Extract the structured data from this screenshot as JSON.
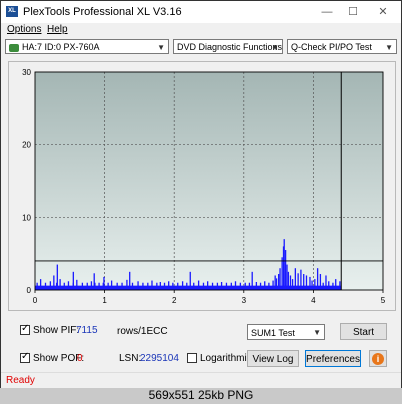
{
  "window": {
    "title": "PlexTools Professional XL V3.16",
    "icon": "XL"
  },
  "menu": [
    "Options",
    "Help"
  ],
  "toolbar": {
    "drive": "HA:7 ID:0  PX-760A",
    "function": "DVD Diagnostic Functions",
    "test": "Q-Check PI/PO Test"
  },
  "chart_data": {
    "type": "bar",
    "xlim": [
      0,
      5
    ],
    "ylim": [
      0,
      30
    ],
    "x_ticks": [
      "0",
      "1",
      "2",
      "3",
      "4",
      "5"
    ],
    "y_ticks": [
      "0",
      "10",
      "20",
      "30"
    ],
    "threshold": 4,
    "data_end_x": 4.4,
    "gridlines": true,
    "colors": {
      "bars": "#1a1aff",
      "grid": "#555555",
      "bg_top": "#a4b6b4",
      "bg_bottom": "#e8f0ee",
      "threshold": "#000000"
    },
    "series": [
      {
        "values": [
          [
            0.03,
            1
          ],
          [
            0.08,
            1.5
          ],
          [
            0.15,
            1
          ],
          [
            0.22,
            1.2
          ],
          [
            0.27,
            2
          ],
          [
            0.31,
            1
          ],
          [
            0.36,
            1.5
          ],
          [
            0.42,
            1
          ],
          [
            0.48,
            1.2
          ],
          [
            0.55,
            1
          ],
          [
            0.6,
            1.4
          ],
          [
            0.68,
            1
          ],
          [
            0.75,
            1
          ],
          [
            0.81,
            1.2
          ],
          [
            0.86,
            1
          ],
          [
            0.92,
            1
          ],
          [
            0.98,
            1
          ],
          [
            0.32,
            3.5
          ],
          [
            0.55,
            2.5
          ],
          [
            0.85,
            2.3
          ],
          [
            0.99,
            1.8
          ],
          [
            1.05,
            1
          ],
          [
            1.1,
            1.3
          ],
          [
            1.18,
            1
          ],
          [
            1.25,
            1
          ],
          [
            1.32,
            1.4
          ],
          [
            1.36,
            2.5
          ],
          [
            1.4,
            1
          ],
          [
            1.48,
            1.2
          ],
          [
            1.55,
            1
          ],
          [
            1.62,
            1
          ],
          [
            1.68,
            1.3
          ],
          [
            1.75,
            1
          ],
          [
            1.8,
            1.1
          ],
          [
            1.86,
            1
          ],
          [
            1.92,
            1.2
          ],
          [
            1.98,
            1
          ],
          [
            2.05,
            1
          ],
          [
            2.12,
            1.2
          ],
          [
            2.18,
            1
          ],
          [
            2.23,
            2.5
          ],
          [
            2.28,
            1
          ],
          [
            2.35,
            1.3
          ],
          [
            2.42,
            1
          ],
          [
            2.48,
            1.2
          ],
          [
            2.55,
            1
          ],
          [
            2.62,
            1
          ],
          [
            2.68,
            1.1
          ],
          [
            2.75,
            1
          ],
          [
            2.82,
            1
          ],
          [
            2.88,
            1.2
          ],
          [
            2.95,
            1
          ],
          [
            3.02,
            1
          ],
          [
            3.08,
            1
          ],
          [
            3.12,
            2.5
          ],
          [
            3.18,
            1.1
          ],
          [
            3.24,
            1
          ],
          [
            3.3,
            1.2
          ],
          [
            3.36,
            1
          ],
          [
            3.42,
            1.3
          ],
          [
            3.45,
            2
          ],
          [
            3.47,
            1.6
          ],
          [
            3.5,
            2.2
          ],
          [
            3.52,
            3
          ],
          [
            3.55,
            4.5
          ],
          [
            3.57,
            6
          ],
          [
            3.58,
            7
          ],
          [
            3.6,
            5.5
          ],
          [
            3.62,
            3.5
          ],
          [
            3.64,
            2.5
          ],
          [
            3.67,
            2
          ],
          [
            3.7,
            1.5
          ],
          [
            3.74,
            3
          ],
          [
            3.78,
            2.3
          ],
          [
            3.82,
            2.8
          ],
          [
            3.86,
            2.2
          ],
          [
            3.9,
            2
          ],
          [
            3.95,
            1.8
          ],
          [
            3.98,
            1.3
          ],
          [
            4.02,
            1.5
          ],
          [
            4.06,
            3
          ],
          [
            4.1,
            2.2
          ],
          [
            4.14,
            1
          ],
          [
            4.18,
            2
          ],
          [
            4.22,
            1.2
          ],
          [
            4.28,
            1
          ],
          [
            4.32,
            1.5
          ],
          [
            4.38,
            1.2
          ]
        ]
      }
    ]
  },
  "controls": {
    "show_pif_label": "Show PIF:",
    "pif_value": "7115",
    "rows_label": "rows/1ECC",
    "show_pof_label": "Show POF:",
    "pof_value": "0",
    "lsn_label": "LSN:",
    "lsn_value": "2295104",
    "logarithmic_label": "Logarithmic",
    "sum_select": "SUM1 Test",
    "start_label": "Start",
    "view_log_label": "View Log",
    "preferences_label": "Preferences",
    "info_icon": "i"
  },
  "status": "Ready",
  "caption": "569x551  25kb  PNG"
}
